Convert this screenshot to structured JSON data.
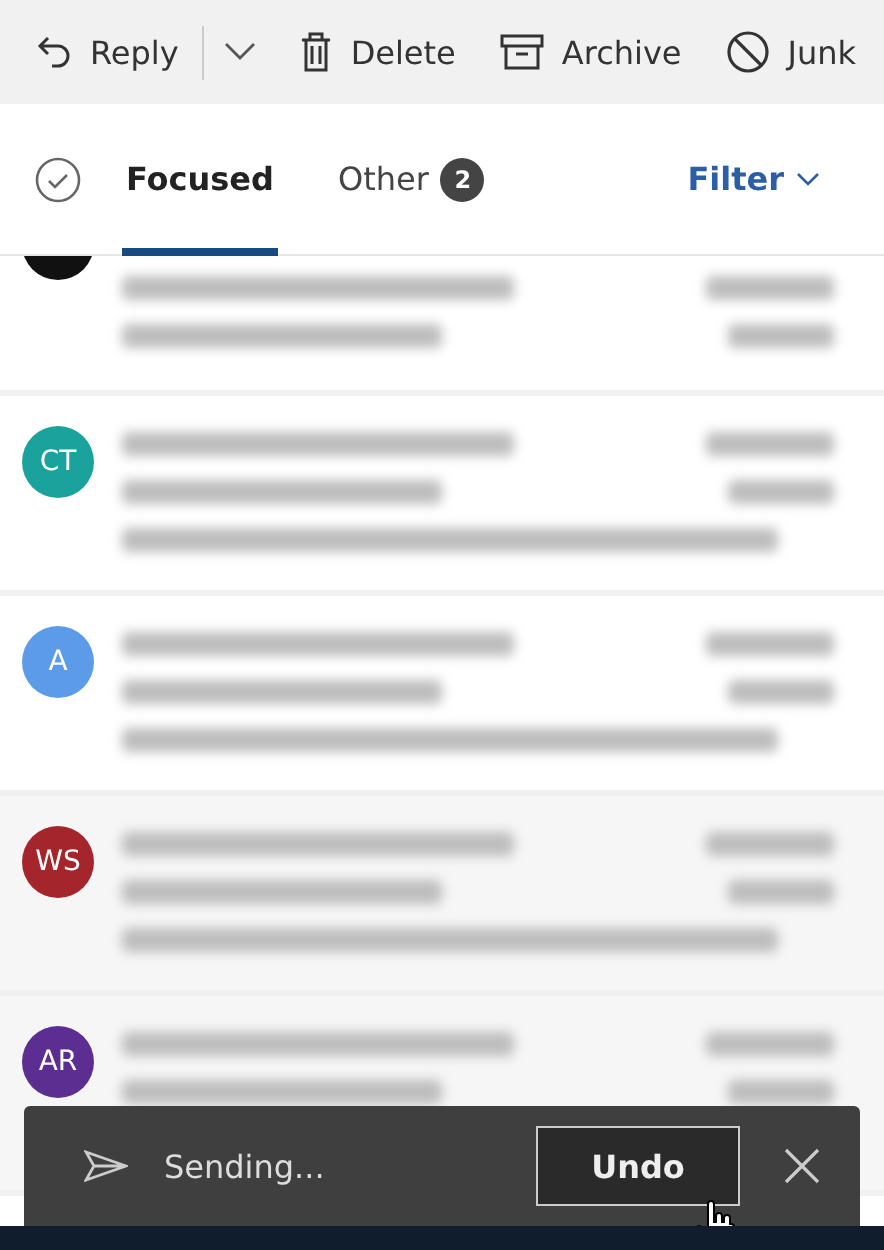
{
  "toolbar": [
    {
      "kind": "reply",
      "label": "Reply"
    },
    {
      "kind": "dropdown"
    },
    {
      "kind": "delete",
      "label": "Delete"
    },
    {
      "kind": "archive",
      "label": "Archive"
    },
    {
      "kind": "junk",
      "label": "Junk"
    }
  ],
  "tabs": [
    {
      "label": "Focused",
      "selected": true
    },
    {
      "label": "Other",
      "selected": false,
      "count": "2"
    }
  ],
  "filter": {
    "label": "Filter"
  },
  "messages": [
    {
      "color": "#111111"
    },
    {
      "initials": "CT",
      "color": "#1aa39d"
    },
    {
      "initials": "A",
      "color": "#5b9be8"
    },
    {
      "initials": "WS",
      "color": "#a4262c"
    },
    {
      "initials": "AR",
      "color": "#5c2e91"
    }
  ],
  "snackbar": {
    "text": "Sending...",
    "action": "Undo"
  }
}
